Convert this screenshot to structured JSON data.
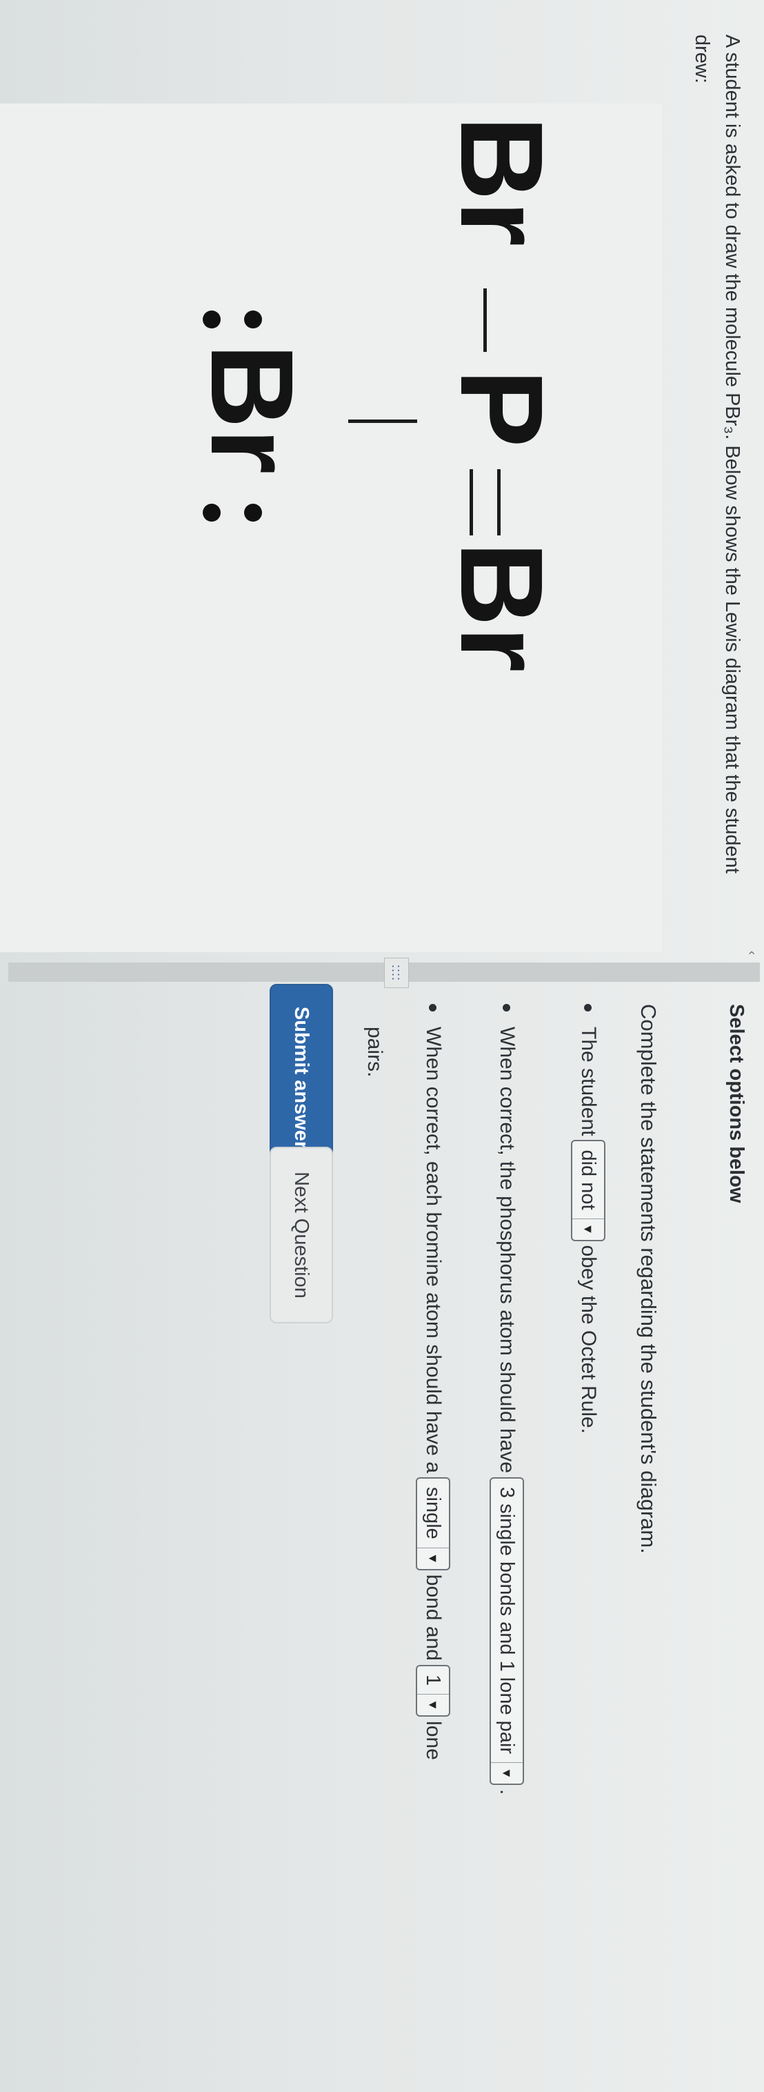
{
  "prompt": {
    "line1": "A student is asked to draw the molecule PBr₃. Below shows the Lewis diagram that the student",
    "line2": "drew:"
  },
  "diagram": {
    "atom_top_left": "Br",
    "atom_center": "P",
    "atom_top_right": "Br",
    "atom_bottom": "Br",
    "lone_pair_symbol": ":"
  },
  "splitter": {
    "grip": "::::",
    "collapse": "‹"
  },
  "options": {
    "title": "Select options below",
    "instruction": "Complete the statements regarding the student's diagram.",
    "s1": {
      "before": "The student",
      "select": "did not",
      "after": "obey the Octet Rule."
    },
    "s2": {
      "before": "When correct, the phosphorus atom should have",
      "select": "3 single bonds and 1 lone pair",
      "after": "."
    },
    "s3": {
      "before": "When correct, each bromine atom should have a",
      "select1": "single",
      "middle": "bond and",
      "select2": "1",
      "after": "lone",
      "cont": "pairs."
    }
  },
  "buttons": {
    "next": "Next Question",
    "submit": "Submit answer"
  },
  "icons": {
    "dropdown": "triangle-down-icon",
    "grip": "drag-grip-icon",
    "collapse": "chevron-left-icon"
  },
  "colors": {
    "submit_bg": "#2e67a8",
    "page_bg": "#e6e9e9"
  }
}
